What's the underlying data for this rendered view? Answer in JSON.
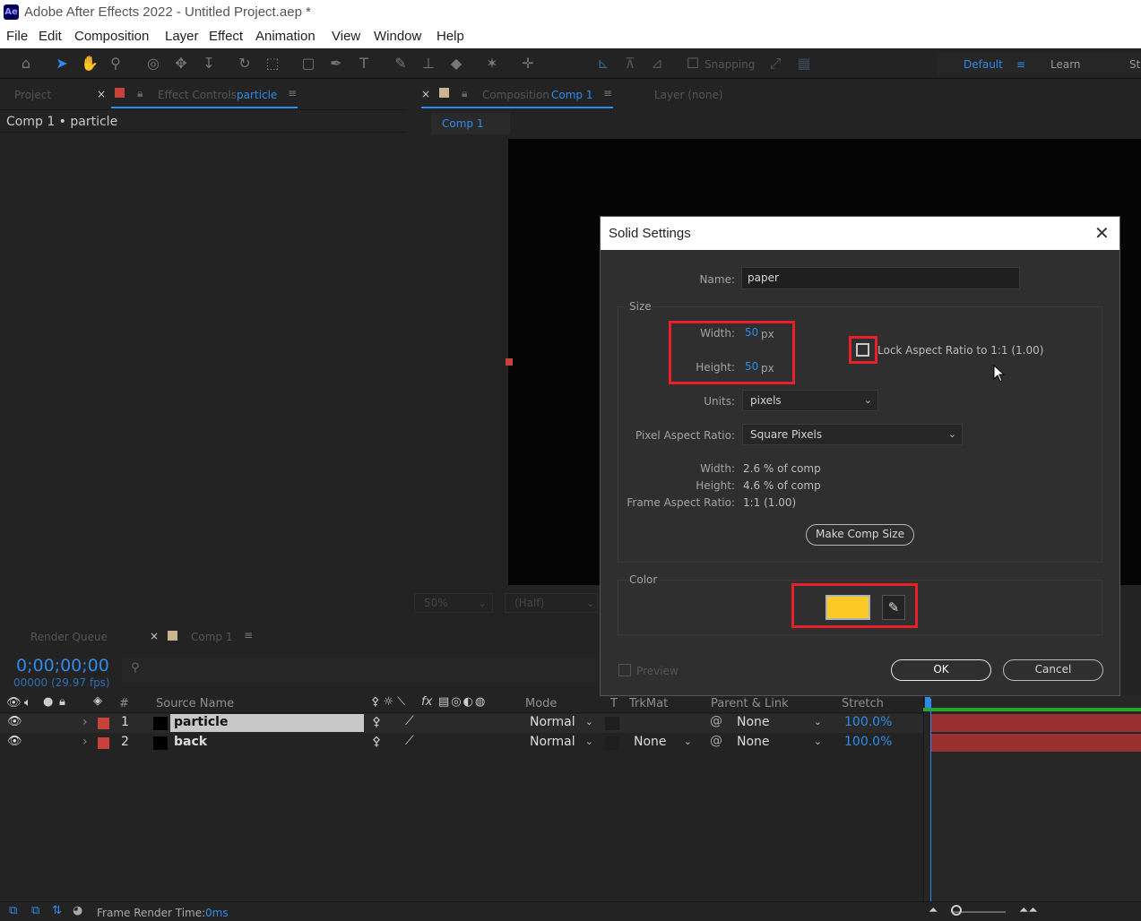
{
  "window": {
    "title": "Adobe After Effects 2022 - Untitled Project.aep *",
    "logo": "Ae"
  },
  "menu": [
    "File",
    "Edit",
    "Composition",
    "Layer",
    "Effect",
    "Animation",
    "View",
    "Window",
    "Help"
  ],
  "toolbar": {
    "snapping": "Snapping",
    "workspace": "Default",
    "learn": "Learn",
    "more": "St"
  },
  "left_panel": {
    "tab_project": "Project",
    "tab_effect_controls": "Effect Controls",
    "tab_effect_target": "particle",
    "breadcrumb": "Comp 1 • particle"
  },
  "comp_panel": {
    "tab_label": "Composition",
    "tab_comp": "Comp 1",
    "layer_tab": "Layer (none)",
    "subtab": "Comp 1",
    "zoom": "50%",
    "resolution": "(Half)"
  },
  "dialog": {
    "title": "Solid Settings",
    "name_label": "Name:",
    "name_value": "paper",
    "size_label": "Size",
    "width_label": "Width:",
    "width_value": "50",
    "width_unit": "px",
    "height_label": "Height:",
    "height_value": "50",
    "height_unit": "px",
    "lock_label": "Lock Aspect Ratio to 1:1 (1.00)",
    "units_label": "Units:",
    "units_value": "pixels",
    "par_label": "Pixel Aspect Ratio:",
    "par_value": "Square Pixels",
    "info_width_label": "Width:",
    "info_width_value": "2.6 % of comp",
    "info_height_label": "Height:",
    "info_height_value": "4.6 % of comp",
    "far_label": "Frame Aspect Ratio:",
    "far_value": "1:1 (1.00)",
    "make_comp_size": "Make Comp Size",
    "color_label": "Color",
    "color_value": "#fcc926",
    "preview_label": "Preview",
    "ok": "OK",
    "cancel": "Cancel"
  },
  "bottom": {
    "render_queue": "Render Queue",
    "comp_tab": "Comp 1",
    "timecode": "0;00;00;00",
    "fps": "00000 (29.97 fps)",
    "headers": {
      "num": "#",
      "source": "Source Name",
      "mode": "Mode",
      "t": "T",
      "trkmat": "TrkMat",
      "parent": "Parent & Link",
      "stretch": "Stretch"
    },
    "layers": [
      {
        "num": "1",
        "name": "particle",
        "mode": "Normal",
        "trkmat": "",
        "parent": "None",
        "stretch": "100.0%",
        "label_color": "#c9423a"
      },
      {
        "num": "2",
        "name": "back",
        "mode": "Normal",
        "trkmat": "None",
        "parent": "None",
        "stretch": "100.0%",
        "label_color": "#c9423a"
      }
    ],
    "status": "Frame Render Time:",
    "status_value": "0ms"
  }
}
